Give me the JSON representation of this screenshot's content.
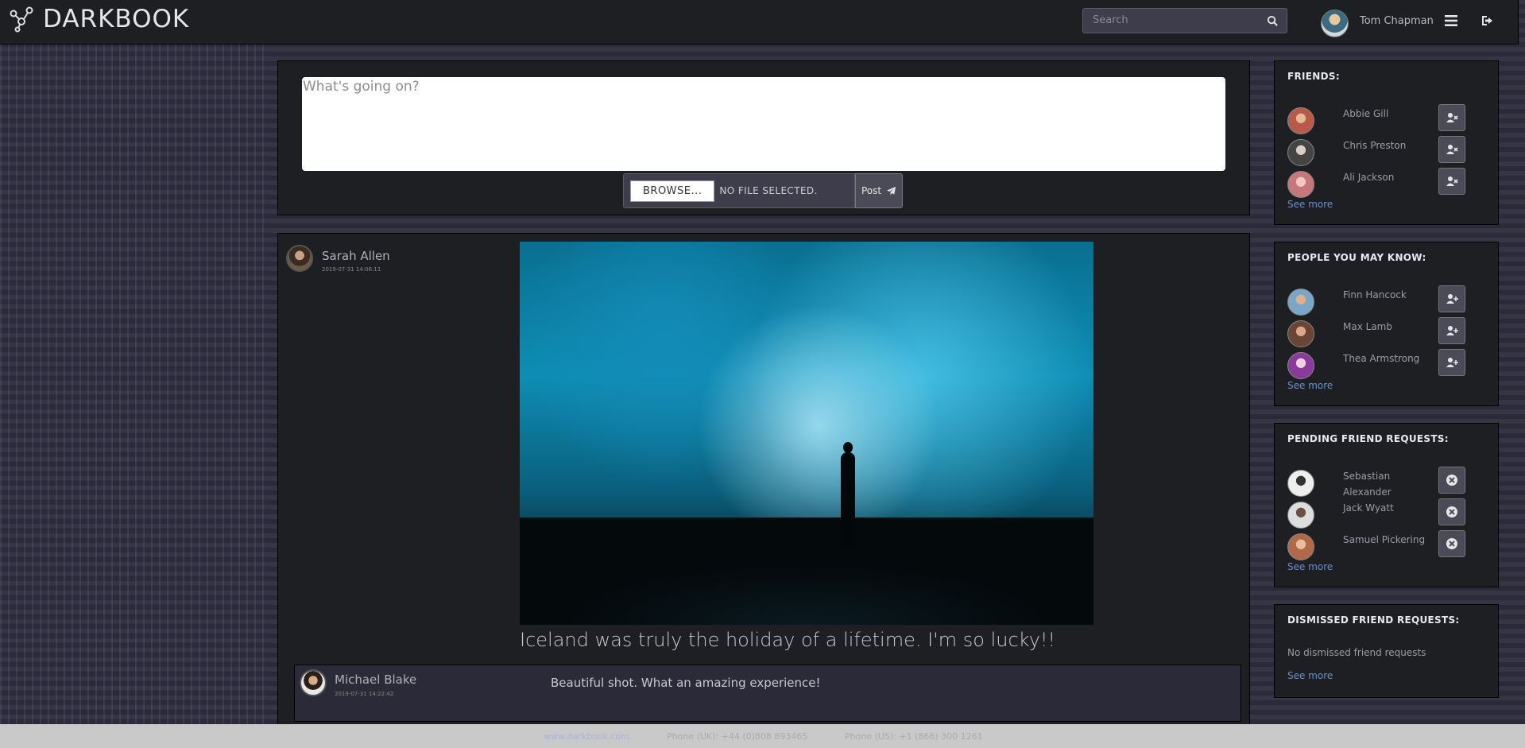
{
  "navbar": {
    "brand": "DARKBOOK",
    "search_placeholder": "Search",
    "user_name": "Tom Chapman"
  },
  "compose": {
    "placeholder": "What's going on?",
    "browse_label": "BROWSE...",
    "no_file_label": "NO FILE SELECTED.",
    "post_label": "Post"
  },
  "post": {
    "author": "Sarah Allen",
    "timestamp": "2019-07-31 14:06:11",
    "caption": "Iceland was truly the holiday of a lifetime. I'm so lucky!!",
    "comment": {
      "author": "Michael Blake",
      "timestamp": "2019-07-31 14:22:42",
      "text": "Beautiful shot. What an amazing experience!"
    }
  },
  "sidebar": {
    "friends": {
      "title": "FRIENDS:",
      "people": [
        {
          "name": "Abbie Gill",
          "avatar_color": "#b85a4a"
        },
        {
          "name": "Chris Preston",
          "avatar_color": "#555555"
        },
        {
          "name": "Ali Jackson",
          "avatar_color": "#c7777a"
        }
      ],
      "see_more": "See more"
    },
    "suggestions": {
      "title": "PEOPLE YOU MAY KNOW:",
      "people": [
        {
          "name": "Finn Hancock",
          "avatar_color": "#7aa7c7"
        },
        {
          "name": "Max Lamb",
          "avatar_color": "#9a6a5a"
        },
        {
          "name": "Thea Armstrong",
          "avatar_color": "#d89ac8"
        }
      ],
      "see_more": "See more"
    },
    "pending": {
      "title": "PENDING FRIEND REQUESTS:",
      "people": [
        {
          "name": "Sebastian Alexander",
          "avatar_color": "#3a3a3a"
        },
        {
          "name": "Jack Wyatt",
          "avatar_color": "#6a5040"
        },
        {
          "name": "Samuel Pickering",
          "avatar_color": "#c89a7a"
        }
      ],
      "see_more": "See more"
    },
    "dismissed": {
      "title": "DISMISSED FRIEND REQUESTS:",
      "empty_text": "No dismissed friend requests",
      "see_more": "See more"
    }
  },
  "footer": {
    "website": "www.darkbook.com",
    "phone_uk": "Phone (UK): +44 (0)808 893465",
    "phone_us": "Phone (US): +1 (866) 300 1261"
  },
  "colors": {
    "background": "#2b2a3a",
    "panel": "#1e1f23",
    "link": "#6b8fd0"
  }
}
